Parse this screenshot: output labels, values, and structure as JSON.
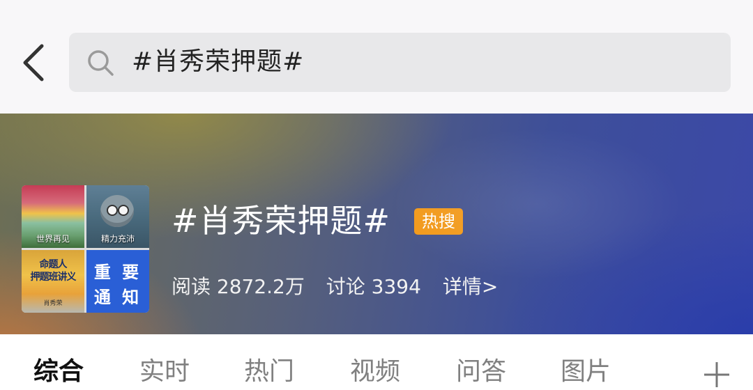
{
  "header": {
    "back_icon": "chevron-left-icon",
    "search": {
      "icon": "search-icon",
      "query": "#肖秀荣押题#"
    }
  },
  "topic": {
    "thumbnail": {
      "tiles": [
        {
          "caption": "世界再见"
        },
        {
          "caption": "精力充沛"
        },
        {
          "lines": [
            "命题人",
            "押题班讲义"
          ],
          "small": "肖秀荣"
        },
        {
          "line1": "重 要",
          "line2": "通 知"
        }
      ]
    },
    "title": "#肖秀荣押题#",
    "badge": "热搜",
    "badge_color": "#f29a1c",
    "stats": {
      "reads": "阅读 2872.2万",
      "discussions": "讨论 3394",
      "detail_link": "详情>"
    }
  },
  "tabs": {
    "items": [
      {
        "label": "综合"
      },
      {
        "label": "实时"
      },
      {
        "label": "热门"
      },
      {
        "label": "视频"
      },
      {
        "label": "问答"
      },
      {
        "label": "图片"
      }
    ],
    "active_index": 0,
    "add_icon": "plus-icon"
  }
}
